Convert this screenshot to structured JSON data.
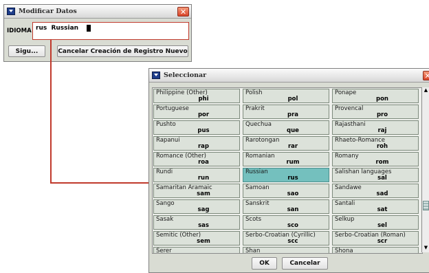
{
  "modify_dialog": {
    "title": "Modificar Datos",
    "close_glyph": "✕",
    "field_label": "IDIOMA",
    "field_value": "rus  Russian",
    "next_button": "Sigu...",
    "cancel_button": "Cancelar Creación de Registro Nuevo"
  },
  "select_dialog": {
    "title": "Seleccionar",
    "ok_button": "OK",
    "cancel_button": "Cancelar",
    "scroll_up_glyph": "▲",
    "scroll_down_glyph": "▼",
    "selected_code": "rus",
    "items": [
      {
        "name": "Philippine (Other)",
        "code": "phi"
      },
      {
        "name": "Polish",
        "code": "pol"
      },
      {
        "name": "Ponape",
        "code": "pon"
      },
      {
        "name": "Portuguese",
        "code": "por"
      },
      {
        "name": "Prakrit",
        "code": "pra"
      },
      {
        "name": "Provencal",
        "code": "pro"
      },
      {
        "name": "Pushto",
        "code": "pus"
      },
      {
        "name": "Quechua",
        "code": "que"
      },
      {
        "name": "Rajasthani",
        "code": "raj"
      },
      {
        "name": "Rapanui",
        "code": "rap"
      },
      {
        "name": "Rarotongan",
        "code": "rar"
      },
      {
        "name": "Rhaeto-Romance",
        "code": "roh"
      },
      {
        "name": "Romance (Other)",
        "code": "roa"
      },
      {
        "name": "Romanian",
        "code": "rum"
      },
      {
        "name": "Romany",
        "code": "rom"
      },
      {
        "name": "Rundi",
        "code": "run"
      },
      {
        "name": "Russian",
        "code": "rus"
      },
      {
        "name": "Salishan languages",
        "code": "sal"
      },
      {
        "name": "Samaritan Aramaic",
        "code": "sam"
      },
      {
        "name": "Samoan",
        "code": "sao"
      },
      {
        "name": "Sandawe",
        "code": "sad"
      },
      {
        "name": "Sango",
        "code": "sag"
      },
      {
        "name": "Sanskrit",
        "code": "san"
      },
      {
        "name": "Santali",
        "code": "sat"
      },
      {
        "name": "Sasak",
        "code": "sas"
      },
      {
        "name": "Scots",
        "code": "sco"
      },
      {
        "name": "Selkup",
        "code": "sel"
      },
      {
        "name": "Semitic (Other)",
        "code": "sem"
      },
      {
        "name": "Serbo-Croatian (Cyrillic)",
        "code": "scc"
      },
      {
        "name": "Serbo-Croatian (Roman)",
        "code": "scr"
      },
      {
        "name": "Serer",
        "code": ""
      },
      {
        "name": "Shan",
        "code": ""
      },
      {
        "name": "Shona",
        "code": ""
      }
    ]
  },
  "colors": {
    "connector_line": "#c0392b",
    "selected_cell": "#74c0be"
  }
}
